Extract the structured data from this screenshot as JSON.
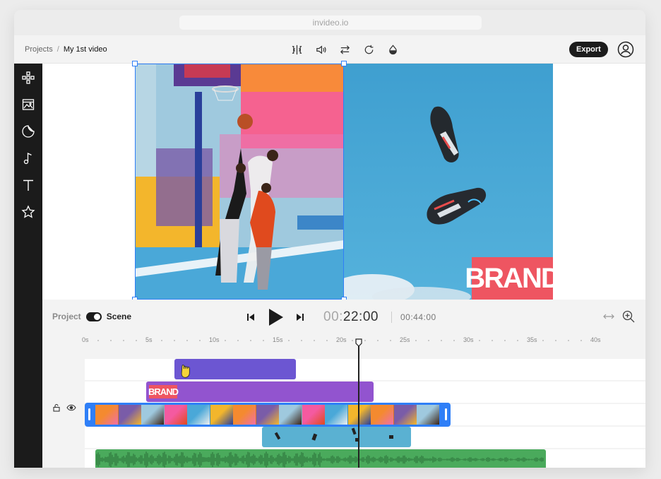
{
  "browser": {
    "url": "invideo.io"
  },
  "breadcrumb": {
    "projects": "Projects",
    "separator": "/",
    "current": "My 1st video"
  },
  "toolbar": {
    "icons": [
      "split-icon",
      "volume-icon",
      "swap-icon",
      "rotate-icon",
      "color-drop-icon"
    ],
    "export_label": "Export"
  },
  "sidebar": {
    "icons": [
      "layout-icon",
      "media-icon",
      "sticker-icon",
      "music-icon",
      "text-icon",
      "star-icon"
    ]
  },
  "canvas": {
    "brand_text": "BRAND"
  },
  "controls": {
    "project_label": "Project",
    "scene_label": "Scene",
    "time_current_dim": "00:",
    "time_current": "22:00",
    "time_total": "00:44:00"
  },
  "timeline": {
    "ticks": [
      "0s",
      "5s",
      "10s",
      "15s",
      "20s",
      "25s",
      "30s",
      "35s",
      "40s"
    ],
    "playhead_seconds": 21.5
  },
  "colors": {
    "accent": "#2f7ff7",
    "sticker_track": "#6c56d2",
    "brand_track": "#9254cf",
    "video_track": "#2f7ff7",
    "sky_track": "#5ab1d2",
    "audio_track": "#4aaa5c",
    "brand_badge": "#ee5561"
  }
}
